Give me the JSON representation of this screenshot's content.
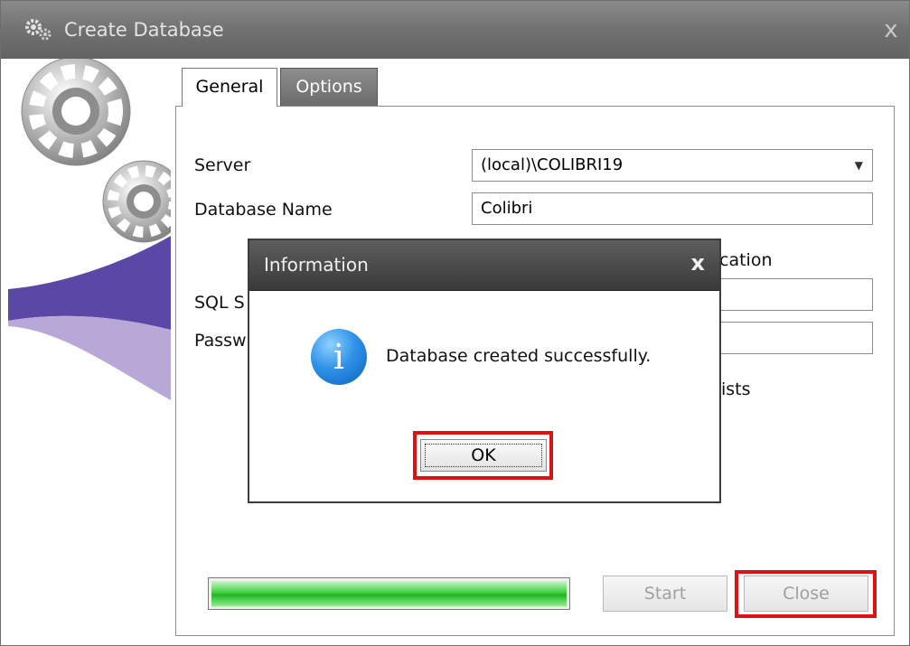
{
  "window": {
    "title": "Create Database",
    "close_glyph": "x",
    "icon": "gears-icon"
  },
  "tabs": [
    {
      "label": "General",
      "active": true
    },
    {
      "label": "Options",
      "active": false
    }
  ],
  "form": {
    "server_label": "Server",
    "server_value": "(local)\\COLIBRI19",
    "dbname_label": "Database Name",
    "dbname_value": "Colibri",
    "auth_label_partial": "cation",
    "sql_label_partial": "SQL S",
    "password_label_partial": "Passw",
    "exists_label_partial": "ists"
  },
  "progress": {
    "value": 1.0,
    "color": "#33c733"
  },
  "buttons": {
    "start_label": "Start",
    "close_label": "Close"
  },
  "dialog": {
    "title": "Information",
    "close_glyph": "x",
    "message": "Database created successfully.",
    "ok_label": "OK",
    "icon": "info-icon",
    "icon_glyph": "i"
  },
  "colors": {
    "highlight": "#e01111",
    "side_art_purple": "#5b47a6"
  }
}
